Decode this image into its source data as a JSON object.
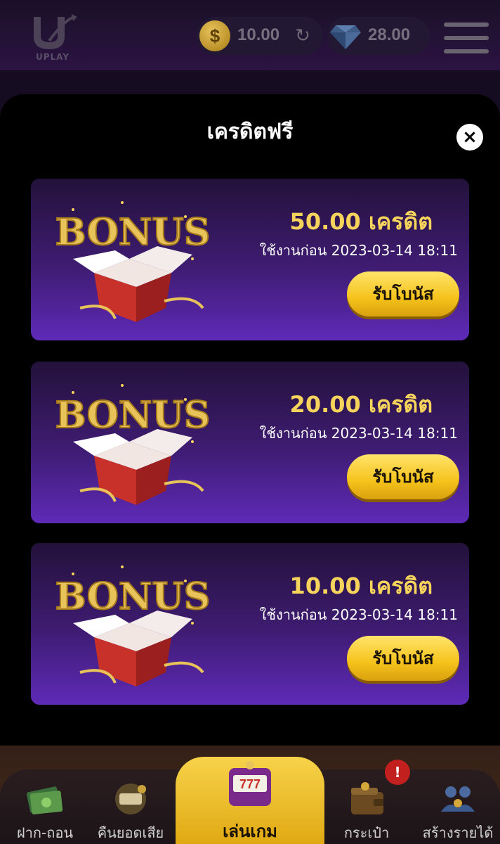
{
  "header": {
    "logo_text": "UPLAY",
    "coin_balance": "10.00",
    "gem_balance": "28.00",
    "icons": [
      "coin-icon",
      "refresh-icon",
      "gem-icon",
      "menu-icon"
    ]
  },
  "modal": {
    "title": "เครดิตฟรี",
    "close_icon": "×",
    "cards": [
      {
        "amount": "50.00 เครดิต",
        "expiry": "ใช้งานก่อน 2023-03-14 18:11",
        "button": "รับโบนัส",
        "art_text": "BONUS"
      },
      {
        "amount": "20.00 เครดิต",
        "expiry": "ใช้งานก่อน 2023-03-14 18:11",
        "button": "รับโบนัส",
        "art_text": "BONUS"
      },
      {
        "amount": "10.00 เครดิต",
        "expiry": "ใช้งานก่อน 2023-03-14 18:11",
        "button": "รับโบนัส",
        "art_text": "BONUS"
      }
    ]
  },
  "bottom_nav": {
    "items": [
      {
        "label": "ฝาก-ถอน",
        "icon": "money-icon"
      },
      {
        "label": "คืนยอดเสีย",
        "icon": "cashback-icon"
      },
      {
        "label": "เล่นเกม",
        "icon": "slot-machine-icon",
        "active": true
      },
      {
        "label": "กระเป๋า",
        "icon": "wallet-icon"
      },
      {
        "label": "สร้างรายได้",
        "icon": "people-icon"
      }
    ],
    "notification_badge": "!"
  },
  "colors": {
    "accent_gold": "#f6d45c",
    "button_gold": "#f5c21a",
    "card_purple": "#5e2ab8",
    "modal_bg": "#000000"
  }
}
